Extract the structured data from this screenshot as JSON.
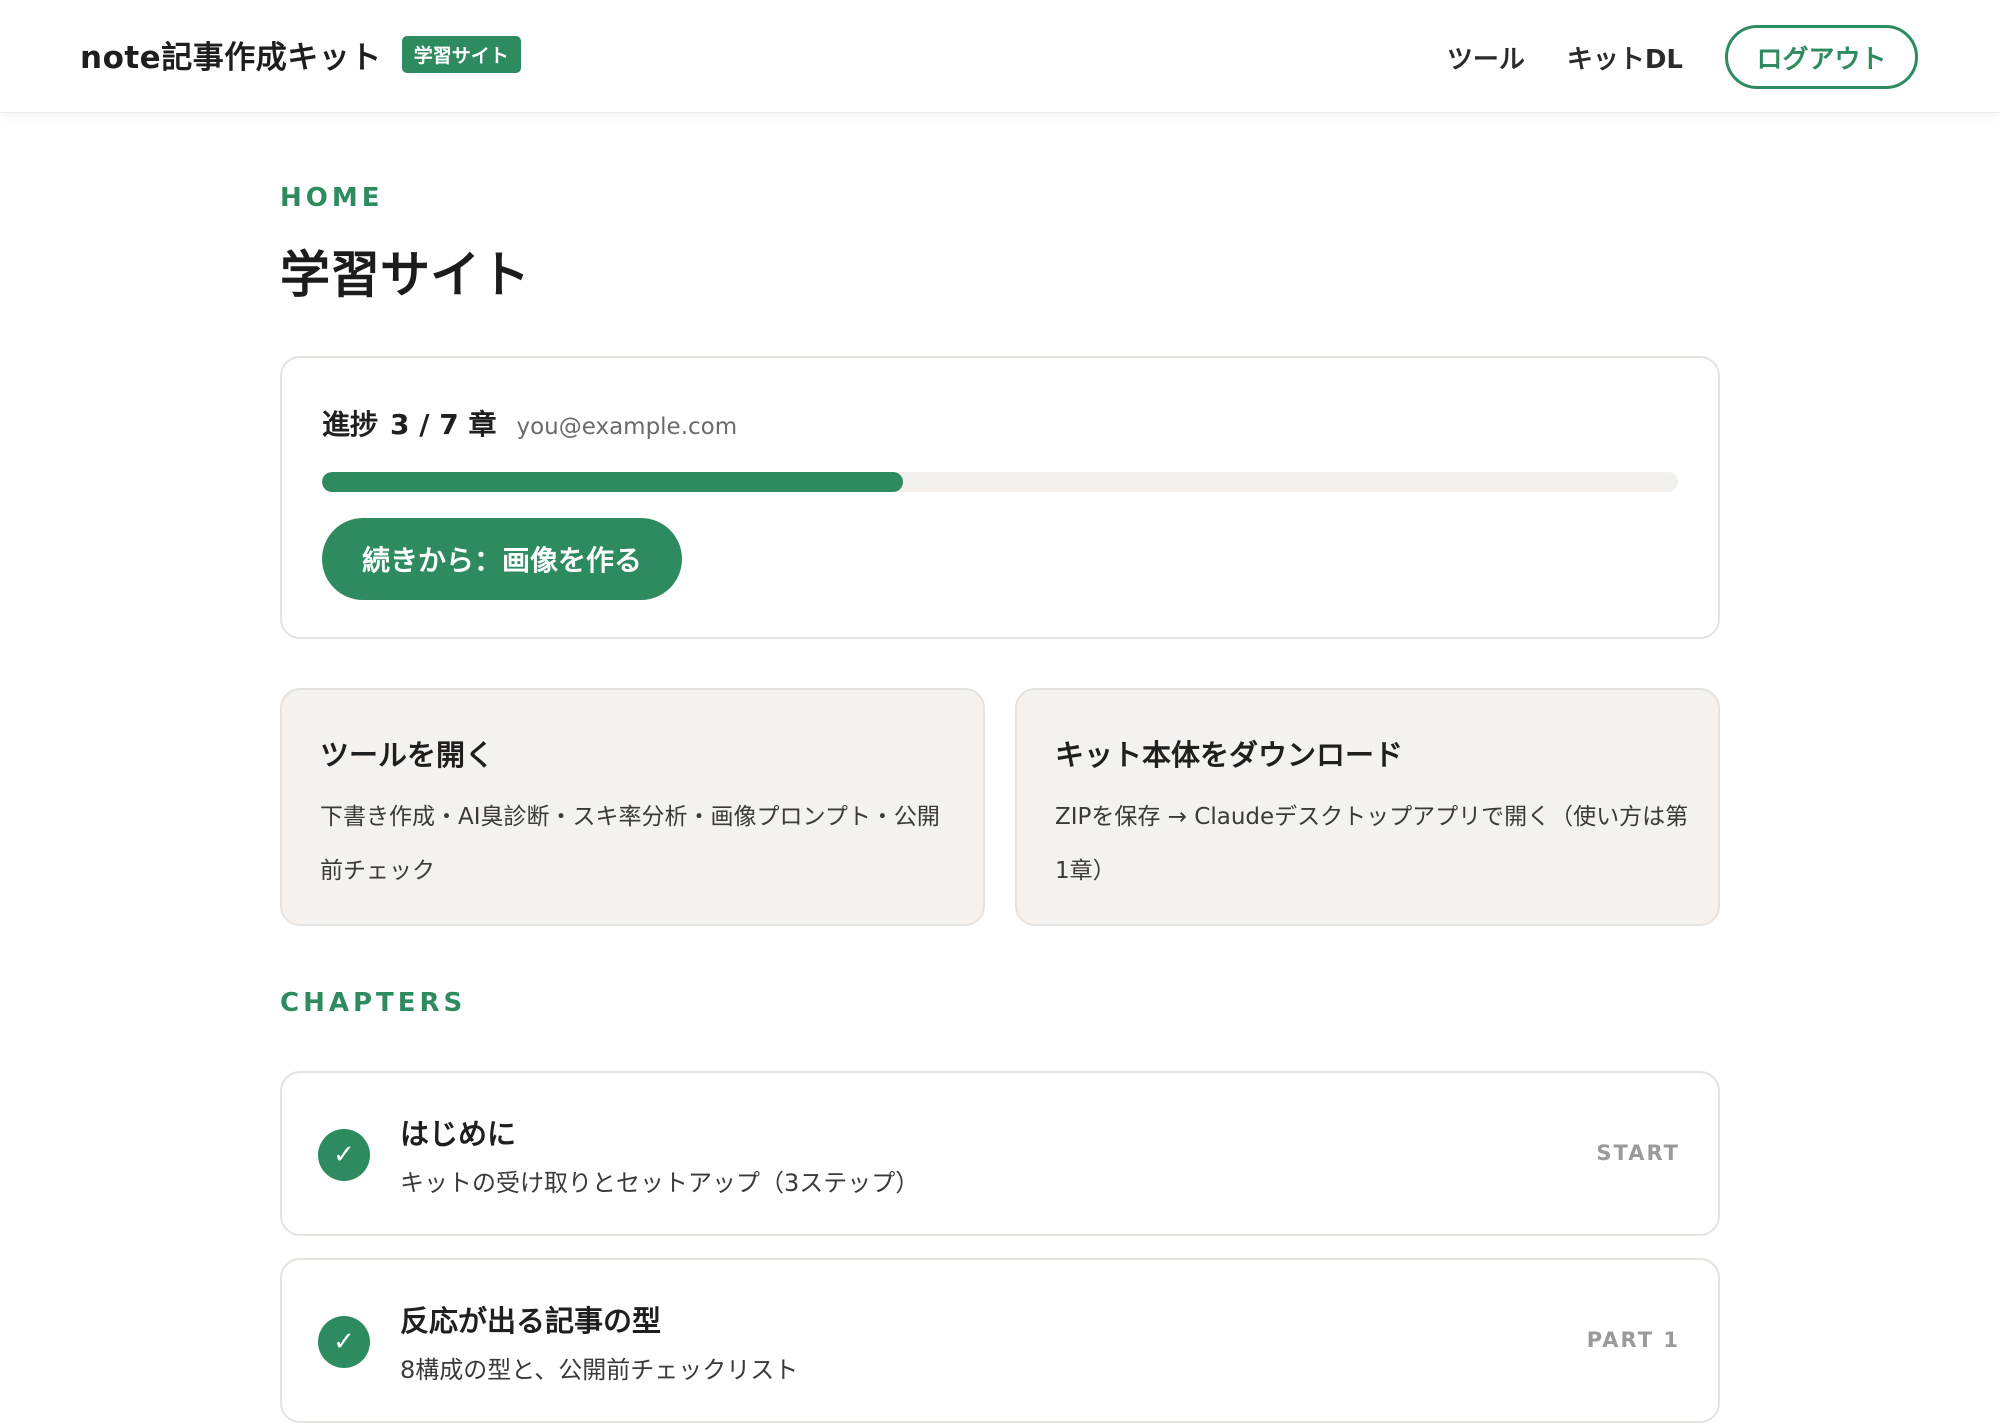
{
  "header": {
    "brand_title": "note記事作成キット",
    "brand_badge": "学習サイト",
    "nav_tools": "ツール",
    "nav_kit_dl": "キットDL",
    "logout_label": "ログアウト"
  },
  "main": {
    "eyebrow_home": "HOME",
    "page_title": "学習サイト",
    "progress": {
      "label": "進捗",
      "count_text": "3 / 7 章",
      "completed": 3,
      "total": 7,
      "email": "you@example.com",
      "continue_label": "続きから：画像を作る"
    },
    "actions": [
      {
        "title": "ツールを開く",
        "description": "下書き作成・AI臭診断・スキ率分析・画像プロンプト・公開前チェック"
      },
      {
        "title": "キット本体をダウンロード",
        "description": "ZIPを保存 → Claudeデスクトップアプリで開く（使い方は第1章）"
      }
    ],
    "eyebrow_chapters": "CHAPTERS",
    "chapters": [
      {
        "title": "はじめに",
        "description": "キットの受け取りとセットアップ（3ステップ）",
        "tag": "START",
        "done": true
      },
      {
        "title": "反応が出る記事の型",
        "description": "8構成の型と、公開前チェックリスト",
        "tag": "PART 1",
        "done": true
      }
    ]
  },
  "icons": {
    "check": "check-icon"
  },
  "colors": {
    "accent": "#2e8b5f",
    "card_bg": "#f4f1ee",
    "track_bg": "#f3efec"
  }
}
